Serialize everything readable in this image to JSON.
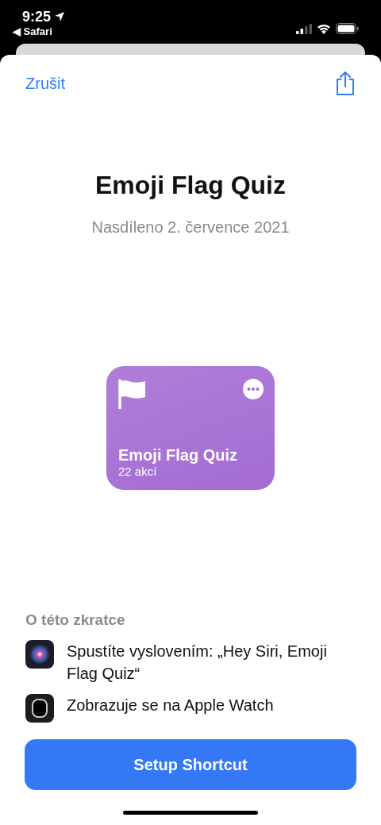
{
  "status_bar": {
    "time": "9:25",
    "back_app": "◀ Safari"
  },
  "nav": {
    "cancel": "Zrušit"
  },
  "title": "Emoji Flag Quiz",
  "subtitle": "Nasdíleno 2. července 2021",
  "shortcut_card": {
    "name": "Emoji Flag Quiz",
    "actions": "22 akcí",
    "color": "#a46bd4"
  },
  "about": {
    "heading": "O této zkratce",
    "items": [
      {
        "kind": "siri",
        "text": "Spustíte vyslovením: „Hey Siri, Emoji Flag Quiz“"
      },
      {
        "kind": "watch",
        "text": "Zobrazuje se na Apple Watch"
      }
    ]
  },
  "primary_button": "Setup Shortcut"
}
